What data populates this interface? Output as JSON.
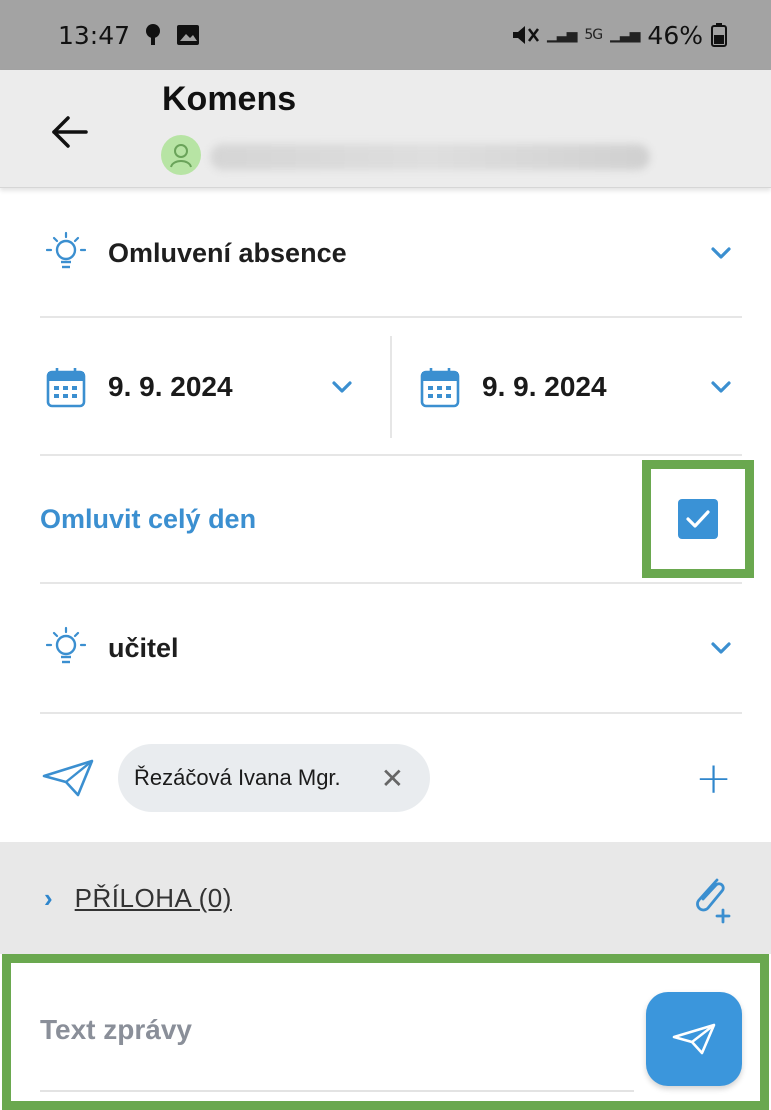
{
  "status_bar": {
    "time": "13:47",
    "battery": "46%",
    "network_label": "5G",
    "icons": [
      "location-icon",
      "image-icon",
      "mute-icon",
      "signal-icon",
      "battery-icon"
    ]
  },
  "app_bar": {
    "title": "Komens",
    "icons": [
      "back-arrow-icon",
      "avatar-icon"
    ]
  },
  "form": {
    "message_type": "Omluvení absence",
    "date_from": "9. 9. 2024",
    "date_to": "9. 9. 2024",
    "whole_day_label": "Omluvit celý den",
    "whole_day_checked": true,
    "recipient_type": "učitel",
    "recipient_chip": "Řezáčová Ivana Mgr.",
    "chip_remove_glyph": "✕",
    "add_glyph": "+"
  },
  "attachments": {
    "arrow_glyph": "›",
    "label": "PŘÍLOHA (0)"
  },
  "compose": {
    "placeholder": "Text zprávy"
  },
  "colors": {
    "accent": "#3b8fd0",
    "status_bar": "#a3a3a3",
    "app_bar": "#ececec",
    "highlight": "#6aa84f",
    "chip_bg": "#e9ecef"
  }
}
